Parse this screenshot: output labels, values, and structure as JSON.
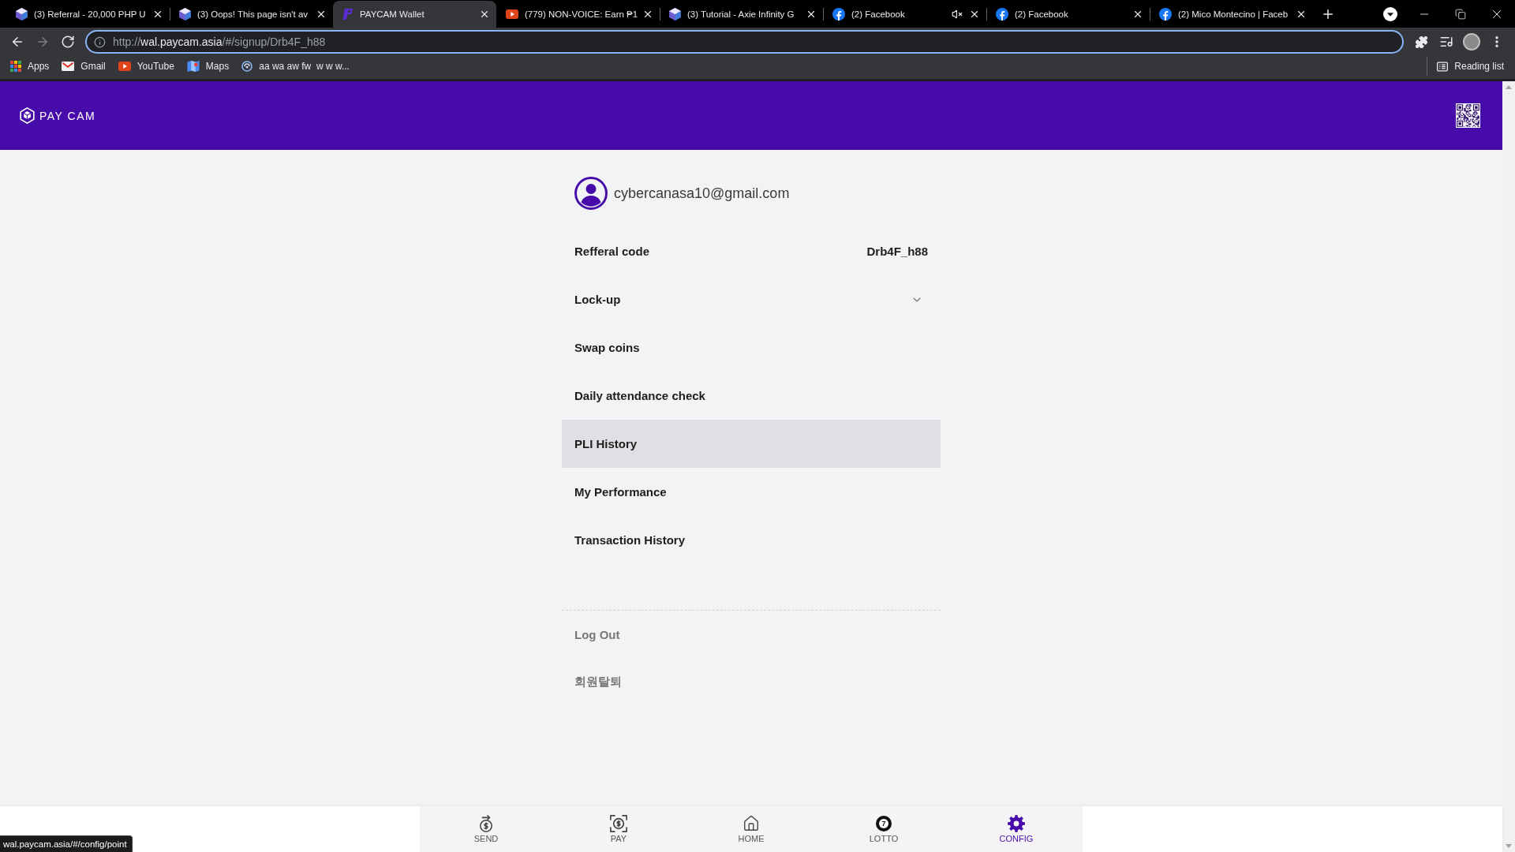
{
  "browser": {
    "tabs": [
      {
        "kind": "cube",
        "title": "(3) Referral - 20,000 PHP U",
        "selected": false,
        "muted": false
      },
      {
        "kind": "cube",
        "title": "(3) Oops! This page isn't av",
        "selected": false,
        "muted": false
      },
      {
        "kind": "paycam",
        "title": "PAYCAM Wallet",
        "selected": true,
        "muted": false
      },
      {
        "kind": "youtube",
        "title": "(779) NON-VOICE: Earn ₱1",
        "selected": false,
        "muted": false
      },
      {
        "kind": "cube",
        "title": "(3) Tutorial - Axie Infinity G",
        "selected": false,
        "muted": false
      },
      {
        "kind": "facebook",
        "title": "(2) Facebook",
        "selected": false,
        "muted": true
      },
      {
        "kind": "facebook",
        "title": "(2) Facebook",
        "selected": false,
        "muted": false
      },
      {
        "kind": "facebook",
        "title": "(2) Mico Montecino | Faceb",
        "selected": false,
        "muted": false
      }
    ],
    "nav_buttons": [
      {
        "kind": "back",
        "disabled": false
      },
      {
        "kind": "forward",
        "disabled": true
      },
      {
        "kind": "reload",
        "disabled": false
      }
    ],
    "address": {
      "scheme": "http://",
      "host": "wal.paycam.asia",
      "path": "/#/signup/Drb4F_h88"
    },
    "bookmarks": [
      {
        "kind": "apps",
        "label": "Apps"
      },
      {
        "kind": "mail",
        "label": "Gmail"
      },
      {
        "kind": "video",
        "label": "YouTube"
      },
      {
        "kind": "map",
        "label": "Maps"
      },
      {
        "kind": "site",
        "label": "aa wa aw fw  w w w..."
      }
    ],
    "reading_list": "Reading list"
  },
  "header": {
    "logo": "PAY CAM"
  },
  "profile": {
    "email": "cybercanasa10@gmail.com"
  },
  "menu": [
    {
      "kind": "value",
      "label": "Refferal code",
      "value": "Drb4F_h88",
      "hovered": false
    },
    {
      "kind": "dropdown",
      "label": "Lock-up",
      "expanded": false,
      "hovered": false
    },
    {
      "kind": "link",
      "label": "Swap coins",
      "hovered": false
    },
    {
      "kind": "link",
      "label": "Daily attendance check",
      "hovered": false
    },
    {
      "kind": "link",
      "label": "PLI History",
      "hovered": true
    },
    {
      "kind": "link",
      "label": "My Performance",
      "hovered": false
    },
    {
      "kind": "link",
      "label": "Transaction History",
      "hovered": false
    }
  ],
  "account_actions": [
    {
      "label": "Log Out"
    },
    {
      "label": "회원탈퇴"
    }
  ],
  "bottom_nav": [
    {
      "kind": "send",
      "label": "SEND",
      "selected": false
    },
    {
      "kind": "pay",
      "label": "PAY",
      "selected": false
    },
    {
      "kind": "home",
      "label": "HOME",
      "selected": false
    },
    {
      "kind": "lotto",
      "label": "LOTTO",
      "number": "7",
      "selected": false
    },
    {
      "kind": "config",
      "label": "CONFIG",
      "selected": true
    }
  ],
  "status_url": "wal.paycam.asia/#/config/point"
}
